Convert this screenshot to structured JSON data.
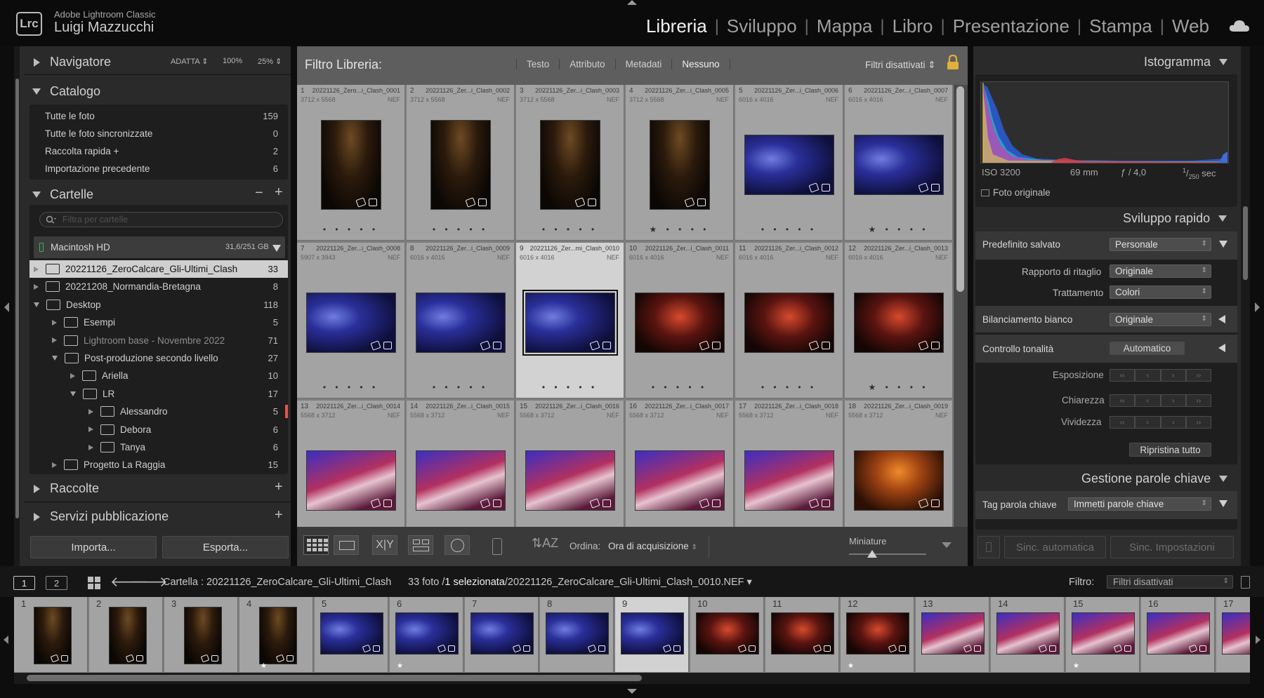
{
  "app": {
    "name": "Adobe Lightroom Classic",
    "logo": "Lrc",
    "user": "Luigi Mazzucchi"
  },
  "modules": [
    {
      "label": "Libreria",
      "active": true
    },
    {
      "label": "Sviluppo"
    },
    {
      "label": "Mappa"
    },
    {
      "label": "Libro"
    },
    {
      "label": "Presentazione"
    },
    {
      "label": "Stampa"
    },
    {
      "label": "Web"
    }
  ],
  "navigator": {
    "title": "Navigatore",
    "fit": "ADATTA",
    "z100": "100%",
    "z25": "25%"
  },
  "catalog": {
    "title": "Catalogo",
    "items": [
      {
        "label": "Tutte le foto",
        "count": "159"
      },
      {
        "label": "Tutte le foto sincronizzate",
        "count": "0"
      },
      {
        "label": "Raccolta rapida +",
        "count": "2"
      },
      {
        "label": "Importazione precedente",
        "count": "6"
      }
    ]
  },
  "folders": {
    "title": "Cartelle",
    "filter_placeholder": "Filtra per cartelle",
    "volume": {
      "name": "Macintosh HD",
      "space": "31,6/251 GB"
    },
    "items": [
      {
        "label": "20221126_ZeroCalcare_Gli-Ultimi_Clash",
        "count": "33",
        "level": 0,
        "expanded": false,
        "selected": true
      },
      {
        "label": "20221208_Normandia-Bretagna",
        "count": "8",
        "level": 0,
        "expanded": false
      },
      {
        "label": "Desktop",
        "count": "118",
        "level": 0,
        "expanded": true
      },
      {
        "label": "Esempi",
        "count": "5",
        "level": 1,
        "expanded": false
      },
      {
        "label": "Lightroom base - Novembre 2022",
        "count": "71",
        "level": 1,
        "expanded": false,
        "dim": true
      },
      {
        "label": "Post-produzione secondo livello",
        "count": "27",
        "level": 1,
        "expanded": true
      },
      {
        "label": "Ariella",
        "count": "10",
        "level": 2,
        "expanded": false
      },
      {
        "label": "LR",
        "count": "17",
        "level": 2,
        "expanded": true
      },
      {
        "label": "Alessandro",
        "count": "5",
        "level": 3,
        "expanded": false,
        "marker": true
      },
      {
        "label": "Debora",
        "count": "6",
        "level": 3,
        "expanded": false
      },
      {
        "label": "Tanya",
        "count": "6",
        "level": 3,
        "expanded": false
      },
      {
        "label": "Progetto La Raggia",
        "count": "15",
        "level": 1,
        "expanded": false
      }
    ]
  },
  "collections": {
    "title": "Raccolte"
  },
  "publish": {
    "title": "Servizi pubblicazione"
  },
  "buttons": {
    "import": "Importa...",
    "export": "Esporta..."
  },
  "filterbar": {
    "title": "Filtro Libreria:",
    "tabs": [
      "Testo",
      "Attributo",
      "Metadati",
      "Nessuno"
    ],
    "status": "Filtri disattivati"
  },
  "photos": [
    {
      "n": "1",
      "name": "20221126_Zero...i_Clash_0001",
      "dim": "3712 x 5568",
      "ext": "NEF",
      "o": "p",
      "tone": "p-warm",
      "stars": "• • • • •"
    },
    {
      "n": "2",
      "name": "20221126_Zer...i_Clash_0002",
      "dim": "3712 x 5568",
      "ext": "NEF",
      "o": "p",
      "tone": "p-warm",
      "stars": "• • • • •"
    },
    {
      "n": "3",
      "name": "20221126_Zer...i_Clash_0003",
      "dim": "3712 x 5568",
      "ext": "NEF",
      "o": "p",
      "tone": "p-warm",
      "stars": "• • • • •"
    },
    {
      "n": "4",
      "name": "20221126_Zer...i_Clash_0005",
      "dim": "3712 x 5568",
      "ext": "NEF",
      "o": "p",
      "tone": "p-warm",
      "stars": "★ • • • •"
    },
    {
      "n": "5",
      "name": "20221126_Zer...i_Clash_0006",
      "dim": "6016 x 4016",
      "ext": "NEF",
      "o": "l",
      "tone": "p-blue",
      "stars": "• • • • •"
    },
    {
      "n": "6",
      "name": "20221126_Zer...i_Clash_0007",
      "dim": "6016 x 4016",
      "ext": "NEF",
      "o": "l",
      "tone": "p-blue",
      "stars": "★ • • • •"
    },
    {
      "n": "7",
      "name": "20221126_Zer...i_Clash_0008",
      "dim": "5907 x 3943",
      "ext": "NEF",
      "o": "l",
      "tone": "p-blue",
      "stars": "• • • • •"
    },
    {
      "n": "8",
      "name": "20221126_Zer...i_Clash_0009",
      "dim": "6016 x 4016",
      "ext": "NEF",
      "o": "l",
      "tone": "p-blue",
      "stars": "• • • • •"
    },
    {
      "n": "9",
      "name": "20221126_Zer...mi_Clash_0010",
      "dim": "6016 x 4016",
      "ext": "NEF",
      "o": "l",
      "tone": "p-blue",
      "stars": "• • • • •",
      "sel": true
    },
    {
      "n": "10",
      "name": "20221126_Zer...i_Clash_0011",
      "dim": "6016 x 4016",
      "ext": "NEF",
      "o": "l",
      "tone": "p-red",
      "stars": "• • • • •"
    },
    {
      "n": "11",
      "name": "20221126_Zer...i_Clash_0012",
      "dim": "6016 x 4016",
      "ext": "NEF",
      "o": "l",
      "tone": "p-red",
      "stars": "• • • • •"
    },
    {
      "n": "12",
      "name": "20221126_Zer...i_Clash_0013",
      "dim": "6016 x 4016",
      "ext": "NEF",
      "o": "l",
      "tone": "p-red",
      "stars": "★ • • • •"
    },
    {
      "n": "13",
      "name": "20221126_Zer...i_Clash_0014",
      "dim": "5568 x 3712",
      "ext": "NEF",
      "o": "l",
      "tone": "p-crowd",
      "stars": ""
    },
    {
      "n": "14",
      "name": "20221126_Zer...i_Clash_0015",
      "dim": "5568 x 3712",
      "ext": "NEF",
      "o": "l",
      "tone": "p-crowd",
      "stars": ""
    },
    {
      "n": "15",
      "name": "20221126_Zer...i_Clash_0016",
      "dim": "5568 x 3712",
      "ext": "NEF",
      "o": "l",
      "tone": "p-crowd",
      "stars": ""
    },
    {
      "n": "16",
      "name": "20221126_Zer...i_Clash_0017",
      "dim": "5568 x 3712",
      "ext": "NEF",
      "o": "l",
      "tone": "p-crowd",
      "stars": ""
    },
    {
      "n": "17",
      "name": "20221126_Zer...i_Clash_0018",
      "dim": "5568 x 3712",
      "ext": "NEF",
      "o": "l",
      "tone": "p-crowd",
      "stars": ""
    },
    {
      "n": "18",
      "name": "20221126_Zer...i_Clash_0019",
      "dim": "5568 x 3712",
      "ext": "NEF",
      "o": "l",
      "tone": "p-orange",
      "stars": ""
    }
  ],
  "toolbar": {
    "sort_label": "Ordina:",
    "sort_value": "Ora di acquisizione",
    "thumbs_label": "Miniature",
    "thumb_size_fraction": 0.3
  },
  "histogram": {
    "title": "Istogramma",
    "iso": "ISO 3200",
    "focal": "69 mm",
    "aperture": "ƒ / 4,0",
    "shutter_num": "1",
    "shutter_den": "250",
    "shutter_unit": "sec",
    "original": "Foto originale"
  },
  "quickdev": {
    "title": "Sviluppo rapido",
    "preset_label": "Predefinito salvato",
    "preset_value": "Personale",
    "crop_label": "Rapporto di ritaglio",
    "crop_value": "Originale",
    "treat_label": "Trattamento",
    "treat_value": "Colori",
    "wb_label": "Bilanciamento bianco",
    "wb_value": "Originale",
    "tone_label": "Controllo tonalità",
    "tone_value": "Automatico",
    "exposure": "Esposizione",
    "clarity": "Chiarezza",
    "vibrance": "Vividezza",
    "reset": "Ripristina tutto"
  },
  "keywords": {
    "title": "Gestione parole chiave",
    "tag_label": "Tag parola chiave",
    "tag_value": "Immetti parole chiave"
  },
  "sync": {
    "auto": "Sinc. automatica",
    "settings": "Sinc. Impostazioni"
  },
  "statusbar": {
    "screen1": "1",
    "screen2": "2",
    "path": "Cartella : 20221126_ZeroCalcare_Gli-Ultimi_Clash",
    "count": "33 foto /",
    "selected": "1 selezionata",
    "file": "/20221126_ZeroCalcare_Gli-Ultimi_Clash_0010.NEF",
    "filter_label": "Filtro:",
    "filter_value": "Filtri disattivati"
  },
  "filmstrip": [
    {
      "n": "1",
      "o": "p",
      "tone": "p-warm"
    },
    {
      "n": "2",
      "o": "p",
      "tone": "p-warm"
    },
    {
      "n": "3",
      "o": "p",
      "tone": "p-warm"
    },
    {
      "n": "4",
      "o": "p",
      "tone": "p-warm",
      "star": "★"
    },
    {
      "n": "5",
      "o": "l",
      "tone": "p-blue"
    },
    {
      "n": "6",
      "o": "l",
      "tone": "p-blue",
      "star": "★"
    },
    {
      "n": "7",
      "o": "l",
      "tone": "p-blue"
    },
    {
      "n": "8",
      "o": "l",
      "tone": "p-blue"
    },
    {
      "n": "9",
      "o": "l",
      "tone": "p-blue",
      "sel": true
    },
    {
      "n": "10",
      "o": "l",
      "tone": "p-red"
    },
    {
      "n": "11",
      "o": "l",
      "tone": "p-red"
    },
    {
      "n": "12",
      "o": "l",
      "tone": "p-red",
      "star": "★"
    },
    {
      "n": "13",
      "o": "l",
      "tone": "p-crowd"
    },
    {
      "n": "14",
      "o": "l",
      "tone": "p-crowd"
    },
    {
      "n": "15",
      "o": "l",
      "tone": "p-crowd",
      "star": "★"
    },
    {
      "n": "16",
      "o": "l",
      "tone": "p-crowd"
    },
    {
      "n": "17",
      "o": "l",
      "tone": "p-crowd"
    }
  ],
  "colors": {
    "accent_red": "#e0574f",
    "volume_green": "#3fb34f"
  }
}
